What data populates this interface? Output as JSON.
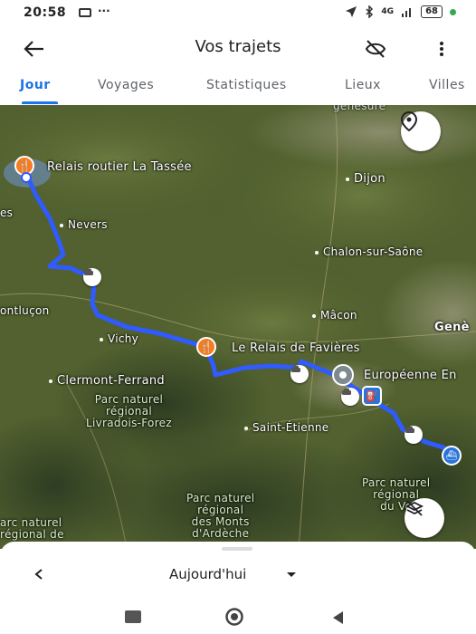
{
  "status_bar": {
    "time": "20:58",
    "dots": "···",
    "network": "4G",
    "battery": "68"
  },
  "appbar": {
    "title": "Vos trajets"
  },
  "tabs": [
    {
      "label": "Jour",
      "active": true
    },
    {
      "label": "Voyages",
      "active": false
    },
    {
      "label": "Statistiques",
      "active": false
    },
    {
      "label": "Lieux",
      "active": false
    },
    {
      "label": "Villes",
      "active": false
    }
  ],
  "map": {
    "labels": {
      "relais_tassee": "Relais routier La Tassée",
      "nevers": "Nevers",
      "dijon": "Dijon",
      "chalon": "Chalon-sur-Saône",
      "montlucon": "ontluçon",
      "vichy": "Vichy",
      "macon": "Mâcon",
      "geneve": "Genè",
      "relais_favieres": "Le Relais de Favières",
      "europeenne": "Européenne En",
      "clermont": "Clermont-Ferrand",
      "saint_etienne": "Saint-Étienne",
      "edge_es": "es",
      "top_partial": "genesure"
    },
    "parks": {
      "livradois": [
        "Parc naturel",
        "régional",
        "Livradois-Forez"
      ],
      "ardeche": [
        "Parc naturel",
        "régional",
        "des Monts",
        "d'Ardèche"
      ],
      "vercors": [
        "Parc naturel",
        "régional",
        "du Vo"
      ],
      "left_park": [
        "arc naturel",
        "régional de"
      ]
    },
    "route_color": "#2f5bff",
    "pin_orange": "#f57c1f",
    "icons": [
      "location-pin-icon",
      "layers-off-icon",
      "restaurant-icon",
      "car-icon",
      "gas-station-icon",
      "boat-icon"
    ]
  },
  "sheet": {
    "date_label": "Aujourd'hui"
  }
}
